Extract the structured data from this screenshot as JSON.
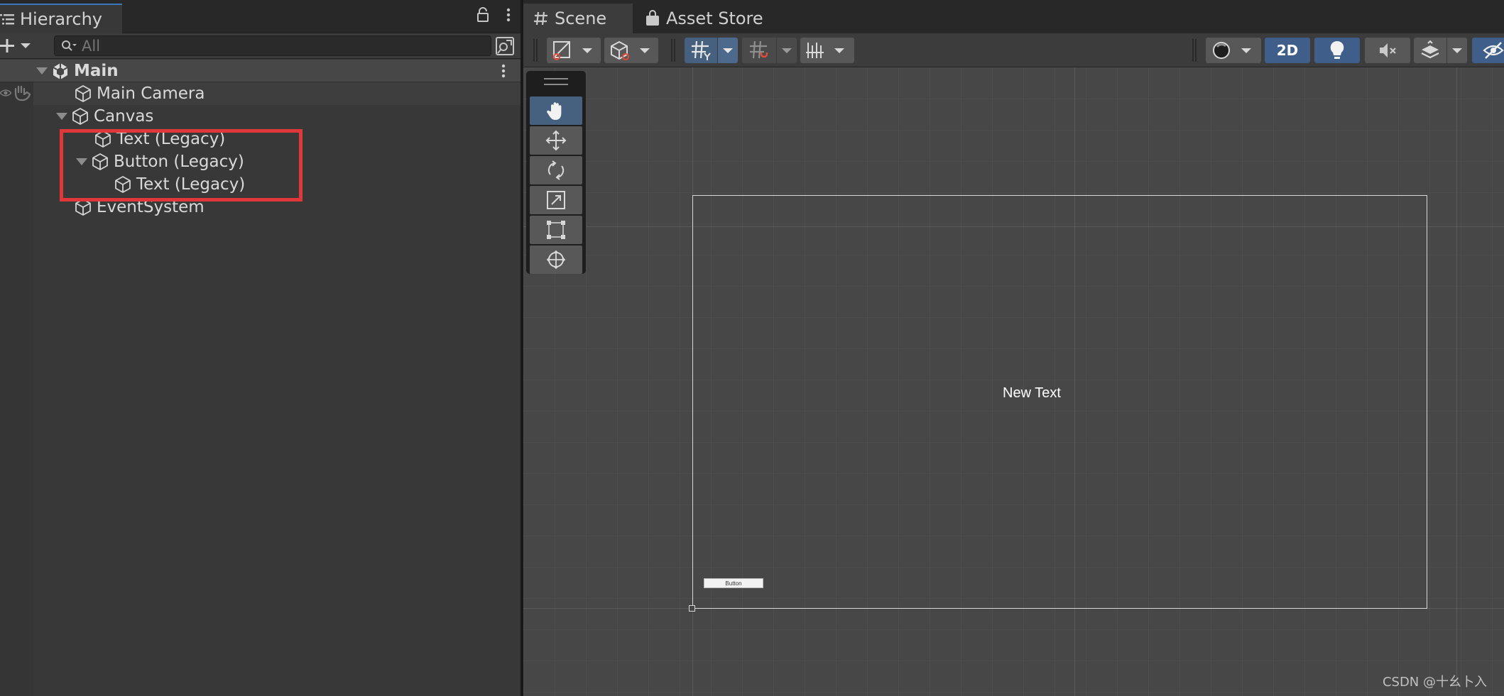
{
  "hierarchy": {
    "tab_label": "Hierarchy",
    "search_placeholder": "All",
    "scene_name": "Main",
    "items": [
      {
        "label": "Main Camera"
      },
      {
        "label": "Canvas"
      },
      {
        "label": "Text (Legacy)"
      },
      {
        "label": "Button (Legacy)"
      },
      {
        "label": "Text (Legacy)"
      },
      {
        "label": "EventSystem"
      }
    ]
  },
  "scene": {
    "tabs": [
      {
        "label": "Scene"
      },
      {
        "label": "Asset Store"
      }
    ],
    "toolbar": {
      "mode_2d_label": "2D"
    },
    "viewport": {
      "canvas_text": "New Text",
      "button_text": "Button"
    }
  },
  "watermark": "CSDN @十幺卜入",
  "colors": {
    "highlight": "#e0383a",
    "accent_blue": "#46607f",
    "panel_bg": "#383838",
    "scene_bg": "#474747"
  }
}
